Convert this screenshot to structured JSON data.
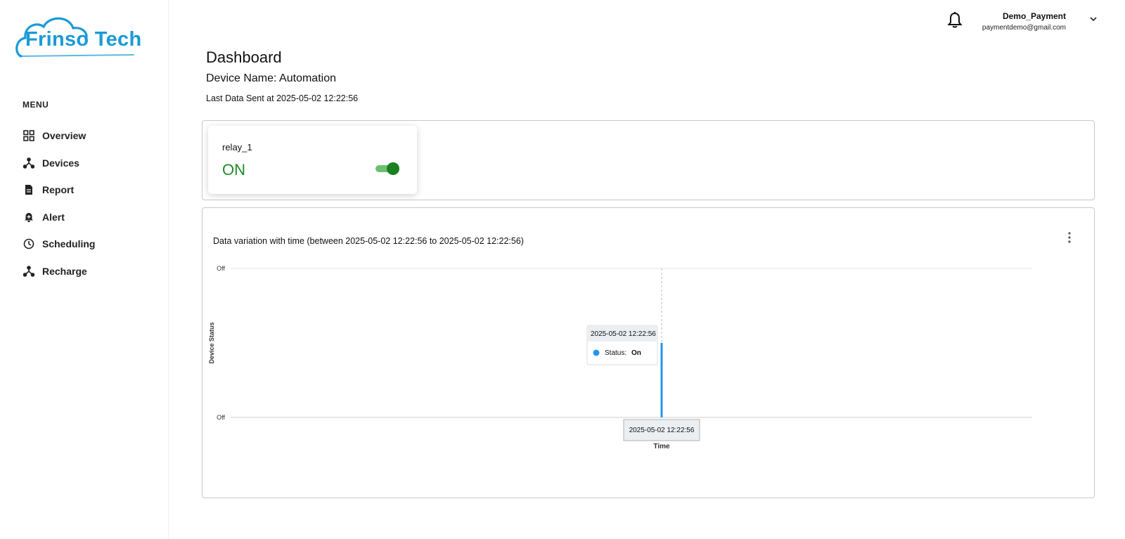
{
  "brand": {
    "name": "Frinso Tech",
    "color": "#1a9ad6"
  },
  "sidebar": {
    "menu_label": "MENU",
    "items": [
      {
        "label": "Overview",
        "icon": "grid-icon"
      },
      {
        "label": "Devices",
        "icon": "network-icon"
      },
      {
        "label": "Report",
        "icon": "document-icon"
      },
      {
        "label": "Alert",
        "icon": "alarm-icon"
      },
      {
        "label": "Scheduling",
        "icon": "clock-icon"
      },
      {
        "label": "Recharge",
        "icon": "network-icon"
      }
    ]
  },
  "header": {
    "user_name": "Demo_Payment",
    "user_email": "paymentdemo@gmail.com",
    "bell_icon": "bell-icon",
    "chevron_icon": "chevron-down-icon"
  },
  "main": {
    "title": "Dashboard",
    "device_name_label": "Device Name: ",
    "device_name": "Automation",
    "last_sent_label": "Last Data Sent at ",
    "last_sent": "2025-05-02 12:22:56"
  },
  "relay": {
    "name": "relay_1",
    "state": "ON",
    "on": true,
    "state_color": "#1d8c2a"
  },
  "chart_panel": {
    "title": "Data variation with time (between 2025-05-02 12:22:56 to 2025-05-02 12:22:56)",
    "menu_icon": "kebab-menu-icon"
  },
  "chart_data": {
    "type": "bar",
    "xlabel": "Time",
    "ylabel": "Device Status",
    "y_tick_labels": [
      "Off",
      "Off"
    ],
    "categories": [
      "2025-05-02 12:22:56"
    ],
    "series": [
      {
        "name": "Status",
        "values": [
          1
        ]
      }
    ],
    "series_color": "#2196f3",
    "tooltip": {
      "time": "2025-05-02 12:22:56",
      "label": "Status:",
      "value": "On"
    },
    "crosshair_label": "2025-05-02 12:22:56",
    "ylim": [
      0,
      2
    ],
    "grid": true
  }
}
